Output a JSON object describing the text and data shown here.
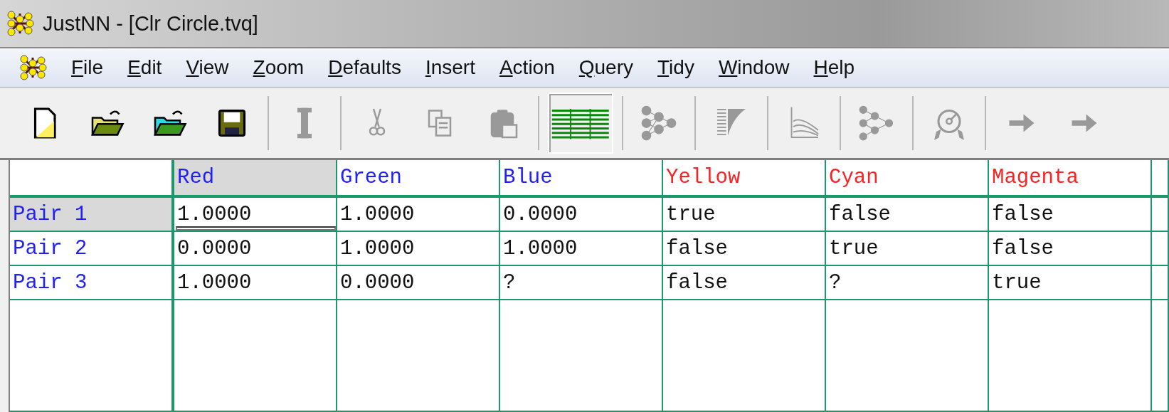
{
  "window": {
    "title": "JustNN - [Clr Circle.tvq]"
  },
  "menu": [
    "File",
    "Edit",
    "View",
    "Zoom",
    "Defaults",
    "Insert",
    "Action",
    "Query",
    "Tidy",
    "Window",
    "Help"
  ],
  "toolbar": [
    {
      "disabled": false,
      "selected": false
    },
    {
      "disabled": false,
      "selected": false
    },
    {
      "disabled": false,
      "selected": false
    },
    {
      "disabled": false,
      "selected": false
    },
    {
      "disabled": true,
      "selected": false
    },
    {
      "disabled": true,
      "selected": false
    },
    {
      "disabled": true,
      "selected": false
    },
    {
      "disabled": true,
      "selected": false
    },
    {
      "disabled": false,
      "selected": true
    },
    {
      "disabled": true,
      "selected": false
    },
    {
      "disabled": true,
      "selected": false
    },
    {
      "disabled": true,
      "selected": false
    },
    {
      "disabled": true,
      "selected": false
    },
    {
      "disabled": true,
      "selected": false
    },
    {
      "disabled": true,
      "selected": false
    },
    {
      "disabled": true,
      "selected": false
    }
  ],
  "grid": {
    "columns": [
      {
        "label": "Red",
        "kind": "input",
        "selected": true
      },
      {
        "label": "Green",
        "kind": "input",
        "selected": false
      },
      {
        "label": "Blue",
        "kind": "input",
        "selected": false
      },
      {
        "label": "Yellow",
        "kind": "output",
        "selected": false
      },
      {
        "label": "Cyan",
        "kind": "output",
        "selected": false
      },
      {
        "label": "Magenta",
        "kind": "output",
        "selected": false
      }
    ],
    "rows": [
      {
        "label": "Pair 1",
        "selected": true,
        "cells": [
          "1.0000",
          "1.0000",
          "0.0000",
          "true",
          "false",
          "false"
        ]
      },
      {
        "label": "Pair 2",
        "selected": false,
        "cells": [
          "0.0000",
          "1.0000",
          "1.0000",
          "false",
          "true",
          "false"
        ]
      },
      {
        "label": "Pair 3",
        "selected": false,
        "cells": [
          "1.0000",
          "0.0000",
          "?",
          "false",
          "?",
          "true"
        ]
      }
    ]
  }
}
